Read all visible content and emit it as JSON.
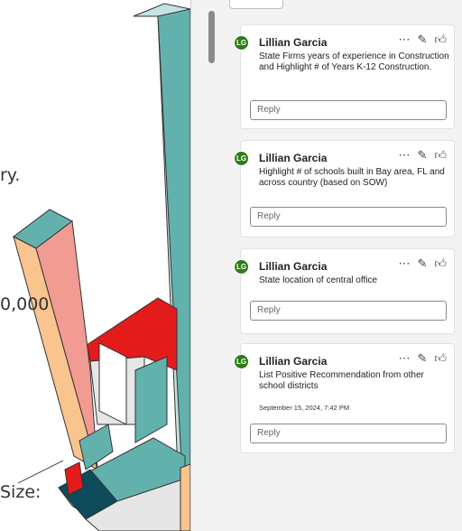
{
  "document": {
    "text_fragments": [
      "ry.",
      "0,000",
      "Size:"
    ]
  },
  "comments": [
    {
      "avatar_initials": "LG",
      "author": "Lillian Garcia",
      "text": "State Firms years of experience in Construction and Highlight # of Years K-12 Construction.",
      "date": "",
      "reply_placeholder": "Reply"
    },
    {
      "avatar_initials": "LG",
      "author": "Lillian Garcia",
      "text": "Highlight # of schools built in Bay area, FL and across country (based on SOW)",
      "date": "",
      "reply_placeholder": "Reply"
    },
    {
      "avatar_initials": "LG",
      "author": "Lillian Garcia",
      "text": "State location of central office",
      "date": "",
      "reply_placeholder": "Reply"
    },
    {
      "avatar_initials": "LG",
      "author": "Lillian Garcia",
      "text": "List Positive Recommendation from other school districts",
      "date": "September 15, 2024, 7:42 PM",
      "reply_placeholder": "Reply"
    }
  ],
  "icons": {
    "more": "more-options-icon",
    "edit": "pencil-icon",
    "like": "thumbs-up-icon"
  },
  "colors": {
    "avatar": "#2e7d16",
    "teal": "#63b1ad",
    "light_teal": "#c4e3e2",
    "salmon": "#f29b93",
    "peach": "#f9c48e",
    "red": "#e31b1b",
    "dark_teal": "#0e4a5a"
  }
}
